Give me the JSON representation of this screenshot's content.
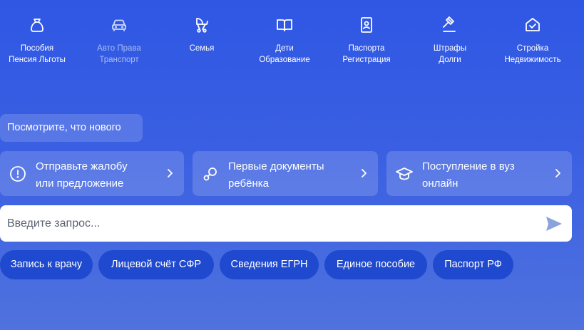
{
  "categories": [
    {
      "icon": "moneybag-icon",
      "line1": "Пособия",
      "line2": "Пенсия Льготы"
    },
    {
      "icon": "car-icon",
      "line1": "Авто Права",
      "line2": "Транспорт"
    },
    {
      "icon": "stroller-icon",
      "line1": "Семья",
      "line2": ""
    },
    {
      "icon": "book-icon",
      "line1": "Дети",
      "line2": "Образование"
    },
    {
      "icon": "passport-icon",
      "line1": "Паспорта",
      "line2": "Регистрация"
    },
    {
      "icon": "gavel-icon",
      "line1": "Штрафы",
      "line2": "Долги"
    },
    {
      "icon": "house-check-icon",
      "line1": "Стройка",
      "line2": "Недвижимость"
    }
  ],
  "whats_new": {
    "label": "Посмотрите, что нового"
  },
  "cards": [
    {
      "icon": "exclamation-circle-icon",
      "line1": "Отправьте жалобу",
      "line2": "или предложение"
    },
    {
      "icon": "pacifier-icon",
      "line1": "Первые документы",
      "line2": "ребёнка"
    },
    {
      "icon": "graduation-cap-icon",
      "line1": "Поступление в вуз",
      "line2": "онлайн"
    }
  ],
  "search": {
    "placeholder": "Введите запрос..."
  },
  "chips": [
    {
      "label": "Запись к врачу"
    },
    {
      "label": "Лицевой счёт СФР"
    },
    {
      "label": "Сведения ЕГРН"
    },
    {
      "label": "Единое пособие"
    },
    {
      "label": "Паспорт РФ"
    }
  ]
}
